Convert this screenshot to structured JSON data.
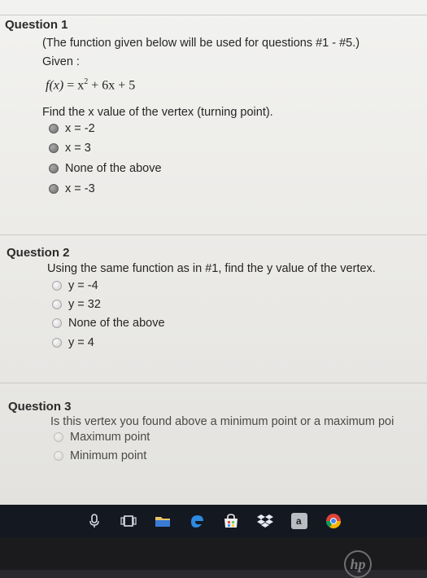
{
  "questions": [
    {
      "title": "Question 1",
      "lines": [
        "(The function given below will be used for questions #1 - #5.)",
        "Given :"
      ],
      "formula": {
        "lhs": "f(x)",
        "rhs_before": "= x",
        "exponent": "2",
        "rhs_after": " + 6x + 5"
      },
      "prompt": "Find the x value of the vertex (turning point).",
      "options": [
        "x = -2",
        "x = 3",
        "None of the above",
        "x = -3"
      ]
    },
    {
      "title": "Question 2",
      "prompt": "Using the same function as in #1, find the y value of the vertex.",
      "options": [
        "y = -4",
        "y = 32",
        "None of the above",
        "y = 4"
      ]
    },
    {
      "title": "Question 3",
      "prompt": "Is this vertex you found above a minimum point or a maximum poi",
      "options": [
        "Maximum point",
        "Minimum point"
      ]
    }
  ],
  "taskbar": {
    "icons": [
      "microphone-icon",
      "task-view-icon",
      "file-explorer-icon",
      "edge-icon",
      "store-icon",
      "dropbox-icon",
      "amazon-icon",
      "chrome-icon"
    ]
  },
  "bezel": {
    "logo": "hp"
  }
}
